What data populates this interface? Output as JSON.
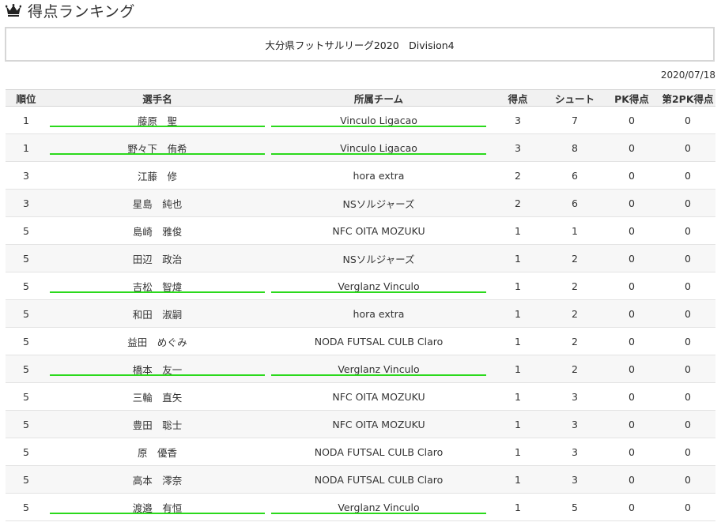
{
  "page": {
    "title": "得点ランキング"
  },
  "league": {
    "name": "大分県フットサルリーグ2020　Division4"
  },
  "date": "2020/07/18",
  "table": {
    "headers": [
      "順位",
      "選手名",
      "所属チーム",
      "得点",
      "シュート",
      "PK得点",
      "第2PK得点"
    ],
    "rows": [
      {
        "rank": "1",
        "player": "藤原　聖",
        "team": "Vinculo Ligacao",
        "goals": "3",
        "shots": "7",
        "pk": "0",
        "pk2": "0",
        "highlight": true
      },
      {
        "rank": "1",
        "player": "野々下　侑希",
        "team": "Vinculo Ligacao",
        "goals": "3",
        "shots": "8",
        "pk": "0",
        "pk2": "0",
        "highlight": true
      },
      {
        "rank": "3",
        "player": "江藤　修",
        "team": "hora extra",
        "goals": "2",
        "shots": "6",
        "pk": "0",
        "pk2": "0",
        "highlight": false
      },
      {
        "rank": "3",
        "player": "星島　純也",
        "team": "NSソルジャーズ",
        "goals": "2",
        "shots": "6",
        "pk": "0",
        "pk2": "0",
        "highlight": false
      },
      {
        "rank": "5",
        "player": "島崎　雅俊",
        "team": "NFC OITA MOZUKU",
        "goals": "1",
        "shots": "1",
        "pk": "0",
        "pk2": "0",
        "highlight": false
      },
      {
        "rank": "5",
        "player": "田辺　政治",
        "team": "NSソルジャーズ",
        "goals": "1",
        "shots": "2",
        "pk": "0",
        "pk2": "0",
        "highlight": false
      },
      {
        "rank": "5",
        "player": "吉松　智煒",
        "team": "Verglanz Vinculo",
        "goals": "1",
        "shots": "2",
        "pk": "0",
        "pk2": "0",
        "highlight": true
      },
      {
        "rank": "5",
        "player": "和田　淑嗣",
        "team": "hora extra",
        "goals": "1",
        "shots": "2",
        "pk": "0",
        "pk2": "0",
        "highlight": false
      },
      {
        "rank": "5",
        "player": "益田　めぐみ",
        "team": "NODA FUTSAL CULB Claro",
        "goals": "1",
        "shots": "2",
        "pk": "0",
        "pk2": "0",
        "highlight": false
      },
      {
        "rank": "5",
        "player": "橋本　友一",
        "team": "Verglanz Vinculo",
        "goals": "1",
        "shots": "2",
        "pk": "0",
        "pk2": "0",
        "highlight": true
      },
      {
        "rank": "5",
        "player": "三輪　直矢",
        "team": "NFC OITA MOZUKU",
        "goals": "1",
        "shots": "3",
        "pk": "0",
        "pk2": "0",
        "highlight": false
      },
      {
        "rank": "5",
        "player": "豊田　聡士",
        "team": "NFC OITA MOZUKU",
        "goals": "1",
        "shots": "3",
        "pk": "0",
        "pk2": "0",
        "highlight": false
      },
      {
        "rank": "5",
        "player": "原　優香",
        "team": "NODA FUTSAL CULB Claro",
        "goals": "1",
        "shots": "3",
        "pk": "0",
        "pk2": "0",
        "highlight": false
      },
      {
        "rank": "5",
        "player": "高本　澪奈",
        "team": "NODA FUTSAL CULB Claro",
        "goals": "1",
        "shots": "3",
        "pk": "0",
        "pk2": "0",
        "highlight": false
      },
      {
        "rank": "5",
        "player": "渡邉　有恒",
        "team": "Verglanz Vinculo",
        "goals": "1",
        "shots": "5",
        "pk": "0",
        "pk2": "0",
        "highlight": true
      }
    ]
  },
  "icons": {
    "title_icon": "crown-icon"
  },
  "colors": {
    "highlight_underline": "#2bd91c",
    "header_bg": "#f1f1f1",
    "alt_row_bg": "#f7f7f7"
  }
}
